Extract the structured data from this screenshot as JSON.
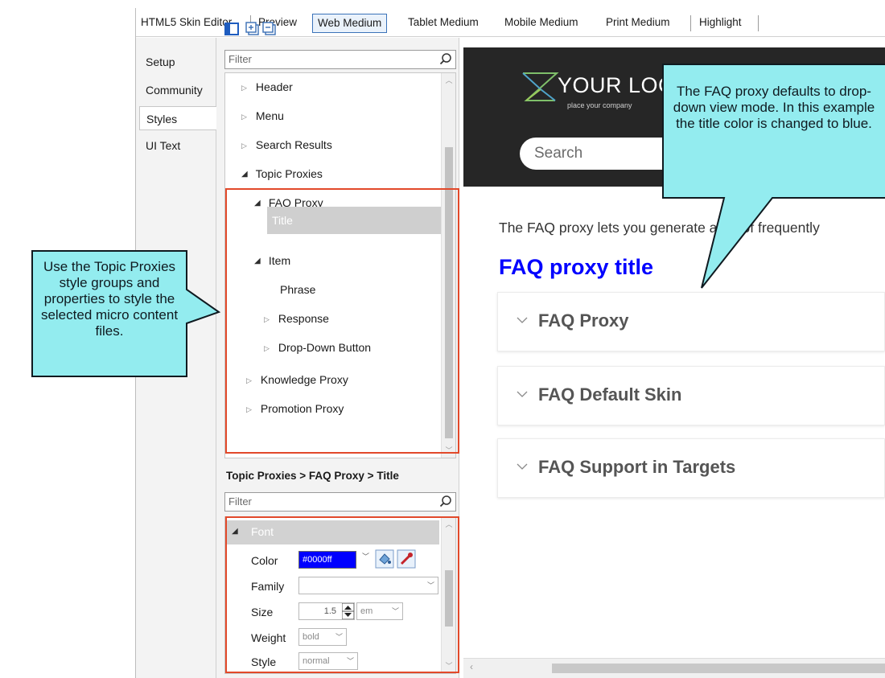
{
  "tabs": [
    {
      "label": "HTML5 Skin Editor"
    },
    {
      "label": "Preview"
    },
    {
      "label": "Web Medium"
    },
    {
      "label": "Tablet Medium"
    },
    {
      "label": "Mobile Medium"
    },
    {
      "label": "Print Medium"
    },
    {
      "label": "Highlight"
    }
  ],
  "left_tabs": [
    {
      "label": "Setup"
    },
    {
      "label": "Community"
    },
    {
      "label": "Styles"
    },
    {
      "label": "UI Text"
    }
  ],
  "tree": {
    "filter_placeholder": "Filter",
    "nodes": [
      {
        "label": "Header"
      },
      {
        "label": "Menu"
      },
      {
        "label": "Search Results"
      },
      {
        "label": "Topic Proxies"
      },
      {
        "label": "FAQ Proxy"
      },
      {
        "label": "Title"
      },
      {
        "label": "Item"
      },
      {
        "label": "Phrase"
      },
      {
        "label": "Response"
      },
      {
        "label": "Drop-Down Button"
      },
      {
        "label": "Knowledge Proxy"
      },
      {
        "label": "Promotion Proxy"
      }
    ]
  },
  "breadcrumb": "Topic Proxies > FAQ Proxy > Title",
  "props": {
    "filter_placeholder": "Filter",
    "group": "Font",
    "color_label": "Color",
    "color_value": "#0000ff",
    "family_label": "Family",
    "family_value": "",
    "size_label": "Size",
    "size_value": "1.5",
    "size_unit": "em",
    "weight_label": "Weight",
    "weight_value": "bold",
    "style_label": "Style",
    "style_value": "normal"
  },
  "preview": {
    "logo": "YOUR LOGO",
    "logo_sub": "place your company",
    "search_placeholder": "Search",
    "intro": "The FAQ proxy lets you generate a list of frequently",
    "faq_title": "FAQ proxy title",
    "items": [
      {
        "label": "FAQ Proxy"
      },
      {
        "label": "FAQ Default Skin"
      },
      {
        "label": "FAQ Support in Targets"
      }
    ]
  },
  "callouts": {
    "left": "Use the Topic Proxies style groups and properties to style the selected micro content files.",
    "right": "The FAQ proxy defaults to drop-down view mode. In this example the title color is changed to blue."
  },
  "colors": {
    "title_blue": "#0000ff",
    "callout_fill": "#93ecef",
    "highlight_red": "#e2492a",
    "hero_dark": "#262626"
  }
}
